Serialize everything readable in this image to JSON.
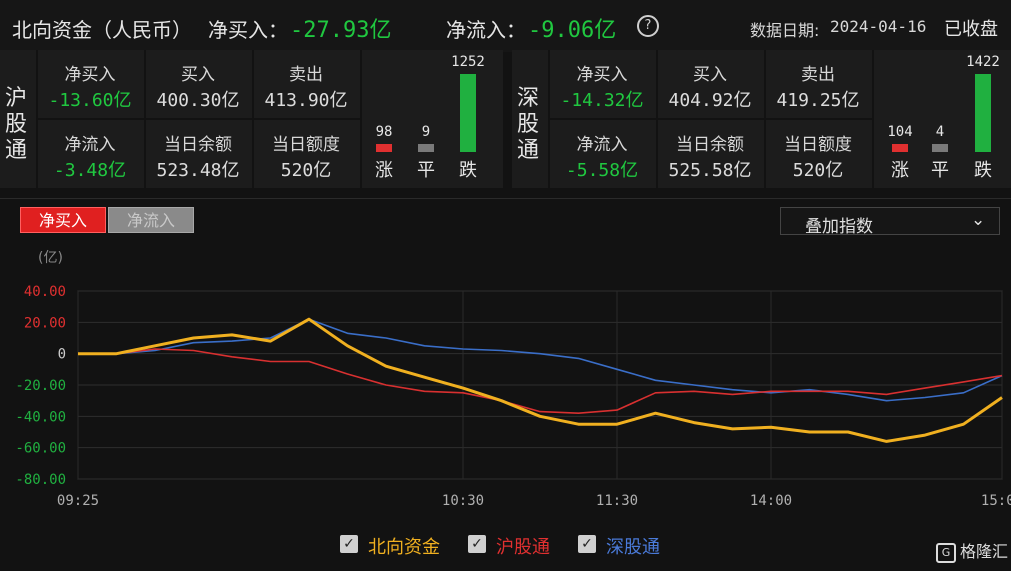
{
  "header": {
    "title": "北向资金（人民币）",
    "net_buy_label": "净买入：",
    "net_buy_value": "-27.93亿",
    "net_flow_label": "净流入：",
    "net_flow_value": "-9.06亿",
    "help_icon": "question-circle-icon",
    "date_label": "数据日期:",
    "date_value": "2024-04-16",
    "status": "已收盘"
  },
  "sh": {
    "name": "沪股通",
    "net_buy_label": "净买入",
    "net_buy": "-13.60亿",
    "buy_label": "买入",
    "buy": "400.30亿",
    "sell_label": "卖出",
    "sell": "413.90亿",
    "net_flow_label": "净流入",
    "net_flow": "-3.48亿",
    "balance_label": "当日余额",
    "balance": "523.48亿",
    "quota_label": "当日额度",
    "quota": "520亿",
    "up": "98",
    "flat": "9",
    "down": "1252",
    "up_label": "涨",
    "flat_label": "平",
    "down_label": "跌"
  },
  "sz": {
    "name": "深股通",
    "net_buy_label": "净买入",
    "net_buy": "-14.32亿",
    "buy_label": "买入",
    "buy": "404.92亿",
    "sell_label": "卖出",
    "sell": "419.25亿",
    "net_flow_label": "净流入",
    "net_flow": "-5.58亿",
    "balance_label": "当日余额",
    "balance": "525.58亿",
    "quota_label": "当日额度",
    "quota": "520亿",
    "up": "104",
    "flat": "4",
    "down": "1422",
    "up_label": "涨",
    "flat_label": "平",
    "down_label": "跌"
  },
  "tabs": {
    "active": "净买入",
    "inactive": "净流入"
  },
  "overlay_select": {
    "label": "叠加指数",
    "icon": "chevron-down-icon"
  },
  "colors": {
    "up": "#e03030",
    "flat": "#7a7a7a",
    "down": "#20b040",
    "north": "#f0b020",
    "sh_line": "#d83030",
    "sz_line": "#3a6ec8"
  },
  "watermark": "格隆汇",
  "chart_data": {
    "type": "line",
    "unit_label": "(亿)",
    "ylim": [
      -80,
      40
    ],
    "yticks": [
      "40.00",
      "20.00",
      "0",
      "-20.00",
      "-40.00",
      "-60.00",
      "-80.00"
    ],
    "ytick_values": [
      40,
      20,
      0,
      -20,
      -40,
      -60,
      -80
    ],
    "xticks": [
      "09:25",
      "10:30",
      "11:30",
      "14:00",
      "15:00"
    ],
    "x": [
      "09:25",
      "09:30",
      "09:35",
      "09:40",
      "09:45",
      "09:50",
      "09:55",
      "10:00",
      "10:10",
      "10:20",
      "10:30",
      "10:45",
      "11:00",
      "11:15",
      "11:30",
      "13:15",
      "13:30",
      "13:45",
      "14:00",
      "14:15",
      "14:30",
      "14:45",
      "14:50",
      "14:55",
      "15:00"
    ],
    "series": [
      {
        "name": "北向资金",
        "values": [
          0,
          0,
          5,
          10,
          12,
          8,
          22,
          5,
          -8,
          -15,
          -22,
          -30,
          -40,
          -45,
          -45,
          -38,
          -44,
          -48,
          -47,
          -50,
          -50,
          -56,
          -52,
          -45,
          -28
        ]
      },
      {
        "name": "沪股通",
        "values": [
          0,
          0,
          3,
          2,
          -2,
          -5,
          -5,
          -13,
          -20,
          -24,
          -25,
          -30,
          -37,
          -38,
          -36,
          -25,
          -24,
          -26,
          -24,
          -24,
          -24,
          -26,
          -22,
          -18,
          -14
        ]
      },
      {
        "name": "深股通",
        "values": [
          0,
          0,
          2,
          7,
          8,
          10,
          22,
          13,
          10,
          5,
          3,
          2,
          0,
          -3,
          -10,
          -17,
          -20,
          -23,
          -25,
          -23,
          -26,
          -30,
          -28,
          -25,
          -14
        ]
      }
    ],
    "grid": true,
    "legend_position": "bottom-center"
  }
}
